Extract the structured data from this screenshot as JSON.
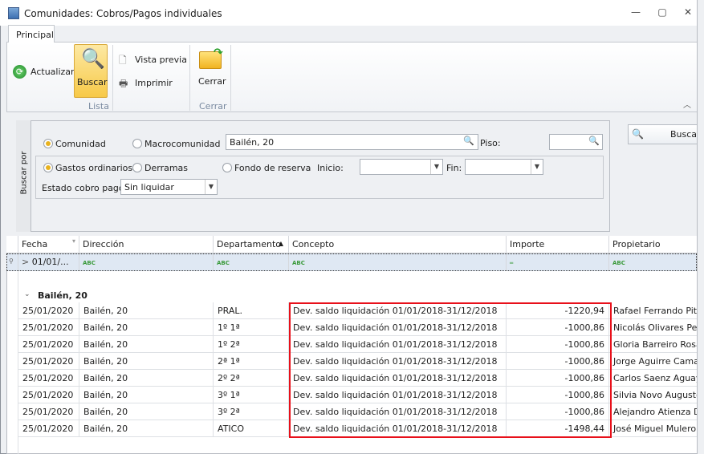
{
  "window": {
    "title": "Comunidades: Cobros/Pagos individuales",
    "minimize": "—",
    "maximize": "▢",
    "close": "✕"
  },
  "ribbon": {
    "tab": "Principal",
    "actualizar": "Actualizar",
    "buscar": "Buscar",
    "vista_previa": "Vista previa",
    "imprimir": "Imprimir",
    "cerrar": "Cerrar",
    "group_lista": "Lista",
    "group_cerrar": "Cerrar",
    "collapse": "︿"
  },
  "filter": {
    "buscar_por": "Buscar por",
    "comunidad": "Comunidad",
    "macrocomunidad": "Macrocomunidad",
    "comunidad_value": "Bailén, 20",
    "piso": "Piso:",
    "piso_value": "",
    "gastos": "Gastos ordinarios",
    "derramas": "Derramas",
    "fondo": "Fondo de reserva",
    "inicio": "Inicio:",
    "inicio_value": "",
    "fin": "Fin:",
    "fin_value": "",
    "estado": "Estado cobro pago:",
    "estado_value": "Sin liquidar",
    "buscar_button": "Buscar"
  },
  "grid": {
    "columns": [
      "Fecha",
      "Dirección",
      "Departamento",
      "Concepto",
      "Importe",
      "Propietario"
    ],
    "filter_fecha": "01/01/...",
    "filter_abc": "ABC",
    "filter_eq": "═",
    "group": "Bailén, 20",
    "rows": [
      {
        "fecha": "25/01/2020",
        "direccion": "Bailén, 20",
        "depto": "PRAL.",
        "concepto": "Dev. saldo liquidación 01/01/2018-31/12/2018",
        "importe": "-1220,94",
        "propietario": "Rafael Ferrando Pitarch"
      },
      {
        "fecha": "25/01/2020",
        "direccion": "Bailén, 20",
        "depto": "1º 1ª",
        "concepto": "Dev. saldo liquidación 01/01/2018-31/12/2018",
        "importe": "-1000,86",
        "propietario": "Nicolás Olivares Perello"
      },
      {
        "fecha": "25/01/2020",
        "direccion": "Bailén, 20",
        "depto": "1º 2ª",
        "concepto": "Dev. saldo liquidación 01/01/2018-31/12/2018",
        "importe": "-1000,86",
        "propietario": "Gloria Barreiro Rosa"
      },
      {
        "fecha": "25/01/2020",
        "direccion": "Bailén, 20",
        "depto": "2ª 1ª",
        "concepto": "Dev. saldo liquidación 01/01/2018-31/12/2018",
        "importe": "-1000,86",
        "propietario": "Jorge Aguirre Camarero"
      },
      {
        "fecha": "25/01/2020",
        "direccion": "Bailén, 20",
        "depto": "2º 2ª",
        "concepto": "Dev. saldo liquidación 01/01/2018-31/12/2018",
        "importe": "-1000,86",
        "propietario": "Carlos Saenz Aguayo"
      },
      {
        "fecha": "25/01/2020",
        "direccion": "Bailén, 20",
        "depto": "3º 1ª",
        "concepto": "Dev. saldo liquidación 01/01/2018-31/12/2018",
        "importe": "-1000,86",
        "propietario": "Silvia Novo Augusto"
      },
      {
        "fecha": "25/01/2020",
        "direccion": "Bailén, 20",
        "depto": "3º 2ª",
        "concepto": "Dev. saldo liquidación 01/01/2018-31/12/2018",
        "importe": "-1000,86",
        "propietario": "Alejandro Atienza Dorado"
      },
      {
        "fecha": "25/01/2020",
        "direccion": "Bailén, 20",
        "depto": "ATICO",
        "concepto": "Dev. saldo liquidación 01/01/2018-31/12/2018",
        "importe": "-1498,44",
        "propietario": "José Miguel Mulero Egea"
      }
    ]
  },
  "colors": {
    "highlight": "#e8101a",
    "accent": "#f7d46a"
  }
}
